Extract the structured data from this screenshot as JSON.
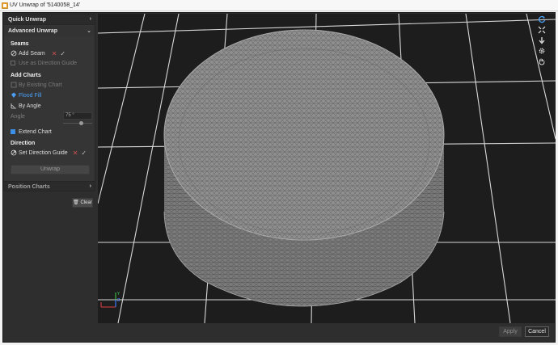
{
  "window": {
    "title": "UV Unwrap of '5140058_14'"
  },
  "panel": {
    "quick_unwrap": "Quick Unwrap",
    "advanced_unwrap": "Advanced Unwrap",
    "seams": {
      "title": "Seams",
      "add_seam": "Add Seam",
      "use_as_direction_guide": "Use as Direction Guide"
    },
    "add_charts": {
      "title": "Add Charts",
      "by_existing_chart": "By Existing Chart",
      "flood_fill": "Flood Fill",
      "by_angle": "By Angle",
      "angle_label": "Angle",
      "angle_value": "75 °",
      "angle_slider_fraction": 0.62,
      "extend_chart": "Extend Chart"
    },
    "direction": {
      "title": "Direction",
      "set_direction_guide": "Set Direction Guide"
    },
    "unwrap_button": "Unwrap",
    "position_charts": "Position Charts"
  },
  "clear_button": "Clear",
  "footer": {
    "apply": "Apply",
    "cancel": "Cancel"
  },
  "icons": {
    "view_tools": [
      "reset-view-icon",
      "fit-view-icon",
      "view-down-icon",
      "settings-icon",
      "pan-hand-icon"
    ]
  },
  "colors": {
    "accent": "#3d8ee6",
    "viewport_bg": "#1d1d1d",
    "grid": "#d8d8d8",
    "mesh": "#8c8c8c",
    "wire": "#5a5a5a",
    "cancel_red": "#d05050"
  }
}
